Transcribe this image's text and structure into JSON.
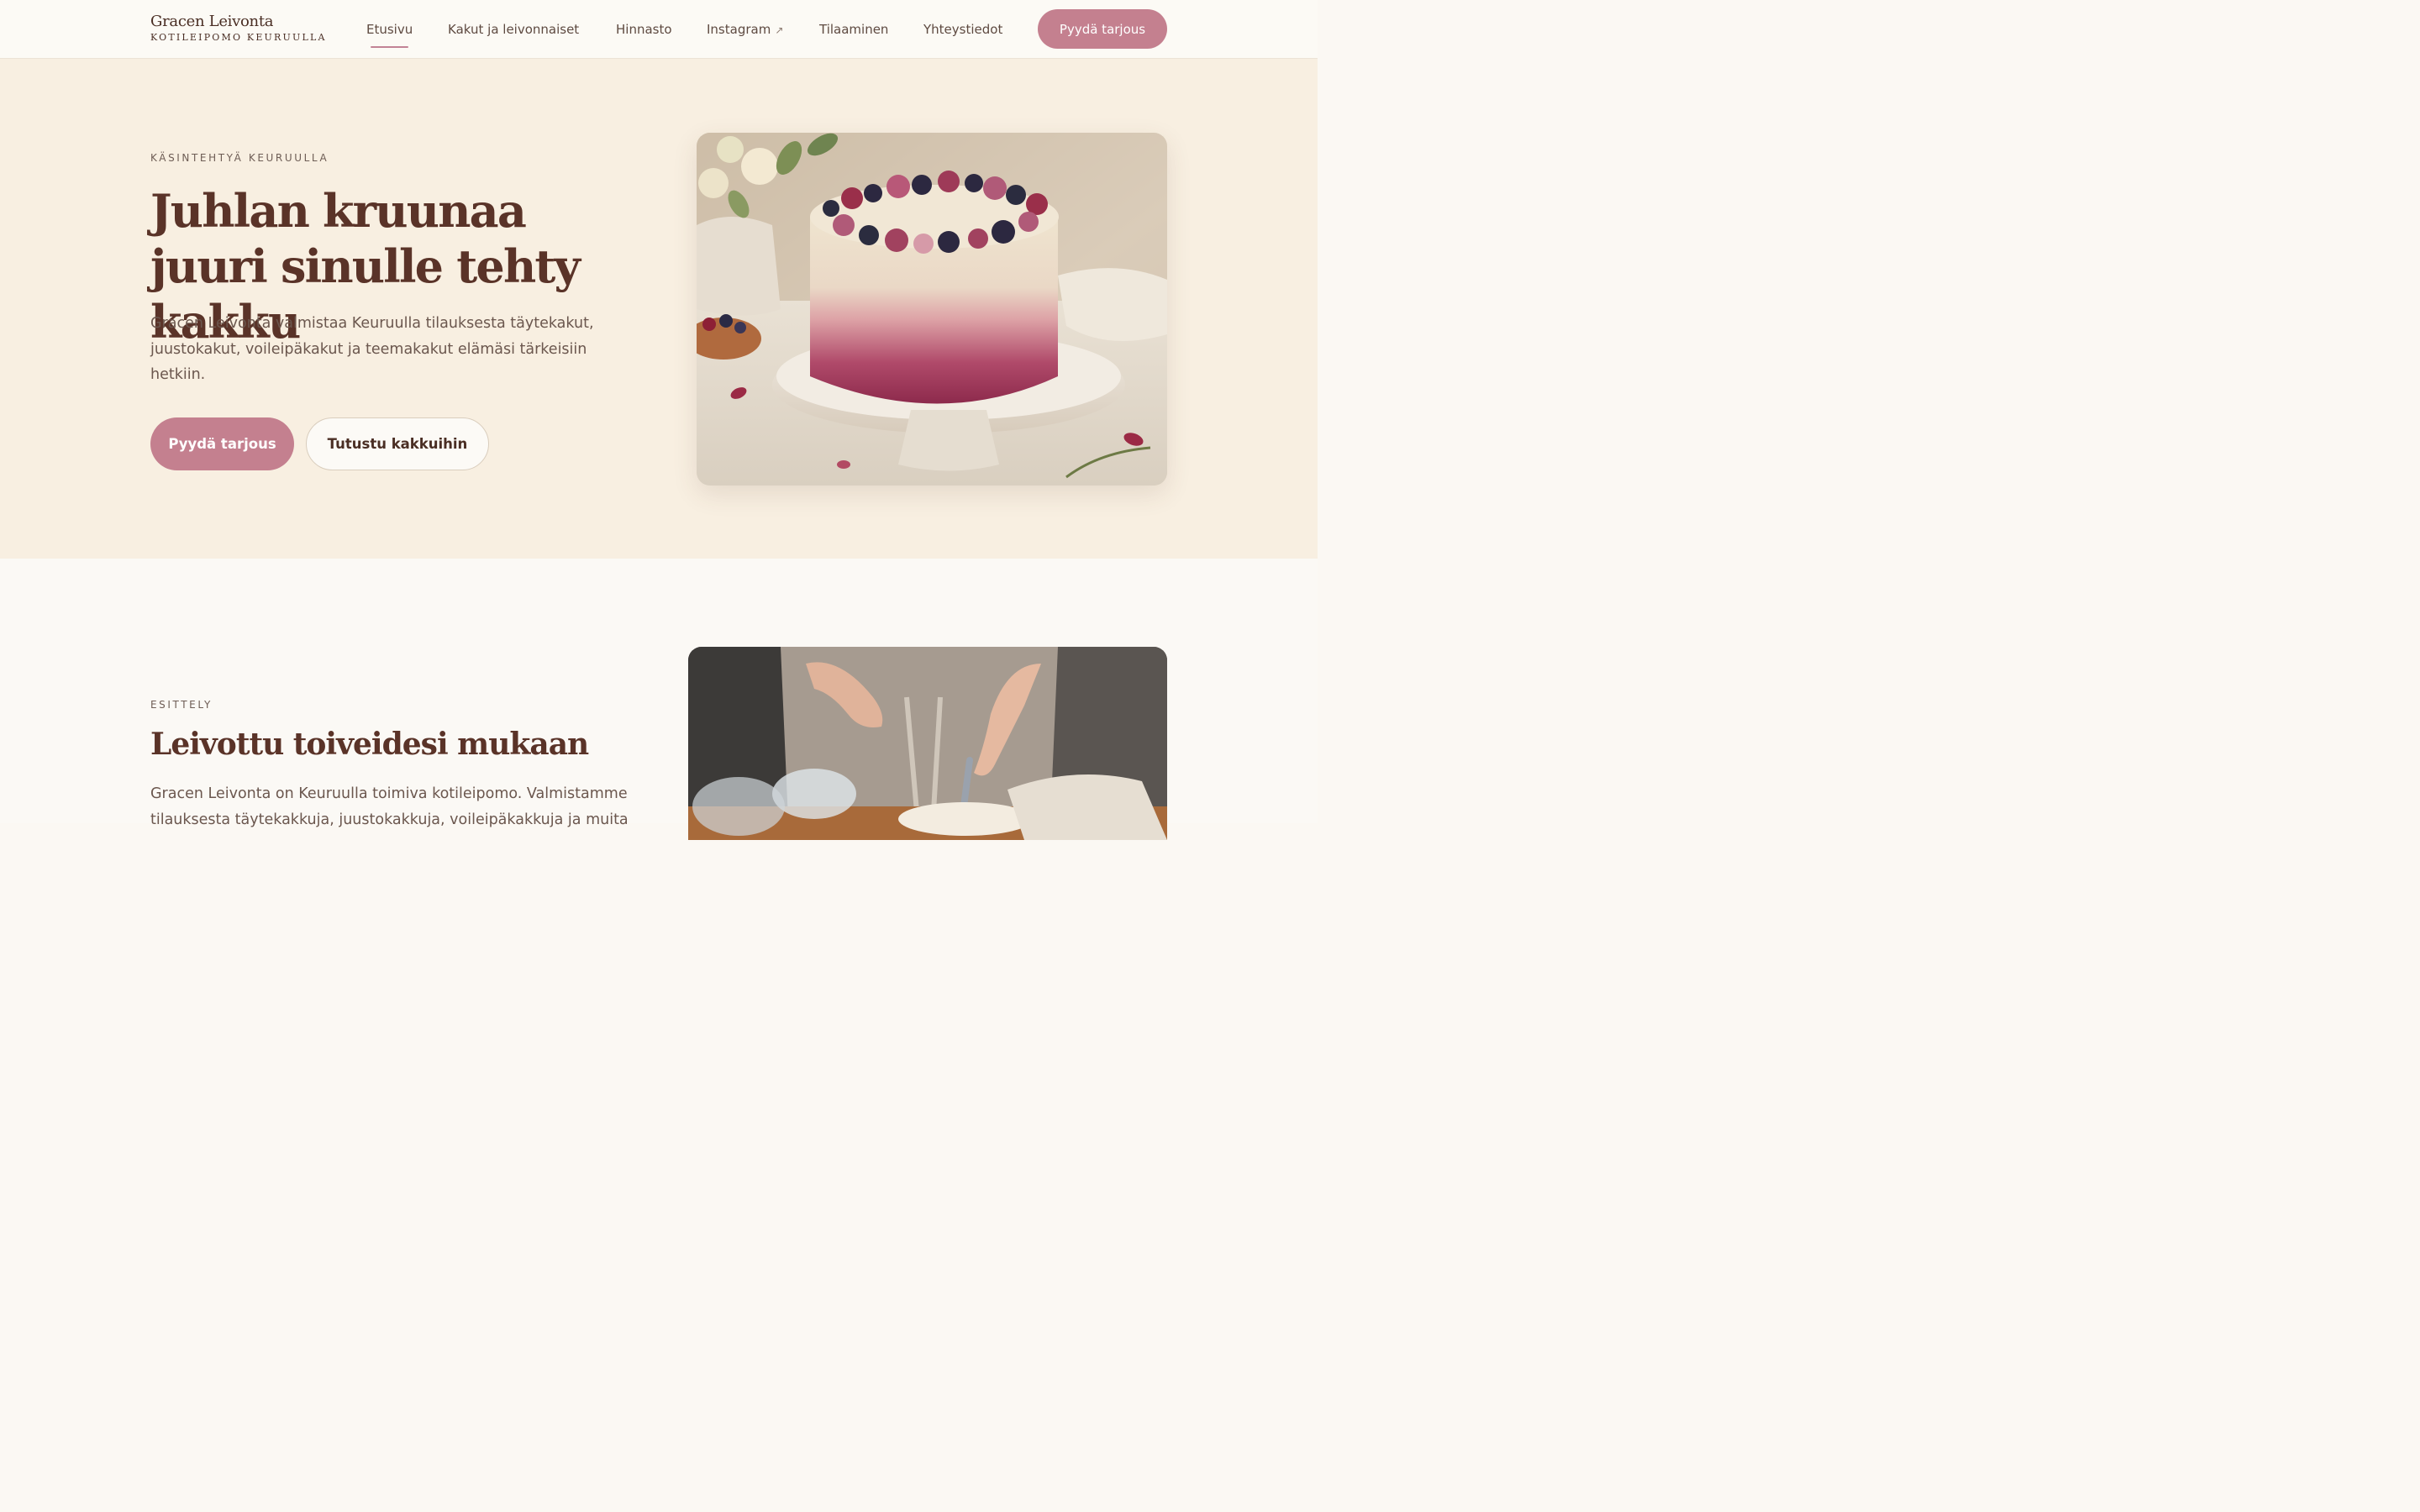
{
  "header": {
    "brand_name": "Gracen Leivonta",
    "brand_tagline": "KOTILEIPOMO KEURUULLA",
    "nav": [
      {
        "label": "Etusivu",
        "active": true
      },
      {
        "label": "Kakut ja leivonnaiset"
      },
      {
        "label": "Hinnasto"
      },
      {
        "label": "Instagram",
        "icon": "external-link-icon"
      },
      {
        "label": "Tilaaminen"
      },
      {
        "label": "Yhteystiedot"
      }
    ],
    "cta_label": "Pyydä tarjous"
  },
  "hero": {
    "eyebrow": "KÄSINTEHTYÄ KEURUULLA",
    "title": "Juhlan kruunaa juuri sinulle tehty kakku",
    "text": "Gracen Leivonta valmistaa Keuruulla tilauksesta täytekakut, juustokakut, voileipäkakut ja teemakakut elämäsi tärkeisiin hetkiin.",
    "primary_button": "Pyydä tarjous",
    "secondary_button": "Tutustu kakkuihin"
  },
  "intro": {
    "eyebrow": "ESITTELY",
    "title": "Leivottu toiveidesi mukaan",
    "text": "Gracen Leivonta on Keuruulla toimiva kotileipomo. Valmistamme tilauksesta täytekakkuja, juustokakkuja, voileipäkakkuja ja muita"
  },
  "colors": {
    "accent": "#c4808f",
    "heading": "#5a3328",
    "hero_background": "#f8efe1",
    "page_background": "#fbf9f5"
  }
}
